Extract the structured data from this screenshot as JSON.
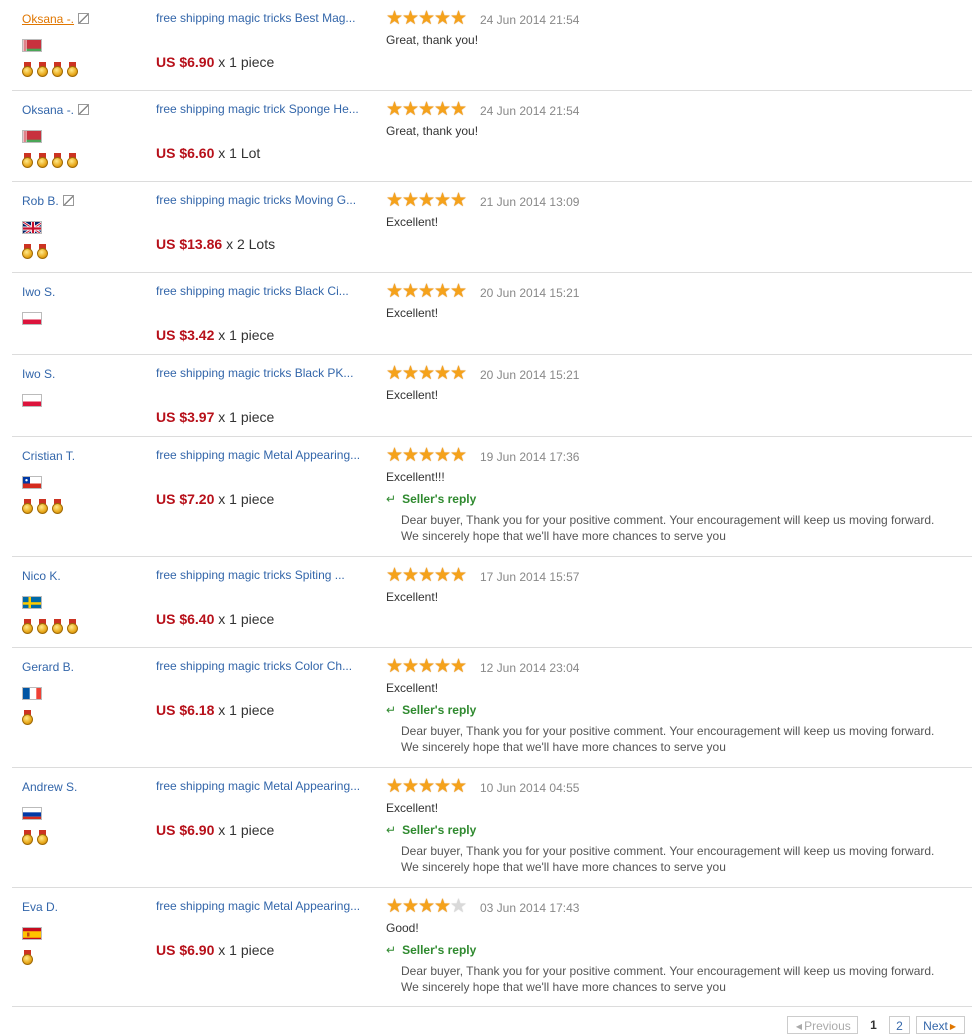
{
  "feedback": [
    {
      "buyer": "Oksana -.",
      "highlight": true,
      "edit_icon": true,
      "flag": "belarus",
      "medals": 4,
      "product": "free shipping magic tricks Best Mag...",
      "price": "US $6.90",
      "qty": "x 1 piece",
      "stars": 5,
      "date": "24 Jun 2014 21:54",
      "comment": "Great, thank you!",
      "reply": null
    },
    {
      "buyer": "Oksana -.",
      "highlight": false,
      "edit_icon": true,
      "flag": "belarus",
      "medals": 4,
      "product": "free shipping magic trick Sponge He...",
      "price": "US $6.60",
      "qty": "x 1 Lot",
      "stars": 5,
      "date": "24 Jun 2014 21:54",
      "comment": "Great, thank you!",
      "reply": null
    },
    {
      "buyer": "Rob B.",
      "highlight": false,
      "edit_icon": true,
      "flag": "uk",
      "medals": 2,
      "product": "free shipping magic tricks Moving G...",
      "price": "US $13.86",
      "qty": "x 2 Lots",
      "stars": 5,
      "date": "21 Jun 2014 13:09",
      "comment": "Excellent!",
      "reply": null
    },
    {
      "buyer": "Iwo S.",
      "highlight": false,
      "edit_icon": false,
      "flag": "poland",
      "medals": 0,
      "product": "free shipping magic tricks Black Ci...",
      "price": "US $3.42",
      "qty": "x 1 piece",
      "stars": 5,
      "date": "20 Jun 2014 15:21",
      "comment": "Excellent!",
      "reply": null
    },
    {
      "buyer": "Iwo S.",
      "highlight": false,
      "edit_icon": false,
      "flag": "poland",
      "medals": 0,
      "product": "free shipping magic tricks Black PK...",
      "price": "US $3.97",
      "qty": "x 1 piece",
      "stars": 5,
      "date": "20 Jun 2014 15:21",
      "comment": "Excellent!",
      "reply": null
    },
    {
      "buyer": "Cristian T.",
      "highlight": false,
      "edit_icon": false,
      "flag": "chile",
      "medals": 3,
      "product": "free shipping magic Metal Appearing...",
      "price": "US $7.20",
      "qty": "x 1 piece",
      "stars": 5,
      "date": "19 Jun 2014 17:36",
      "comment": "Excellent!!!",
      "reply": {
        "title": "Seller's reply",
        "lines": [
          "Dear buyer, Thank you for your positive comment. Your encouragement will keep us moving forward.",
          "We sincerely hope that we'll have more chances to serve you"
        ]
      }
    },
    {
      "buyer": "Nico K.",
      "highlight": false,
      "edit_icon": false,
      "flag": "sweden",
      "medals": 4,
      "product": "free shipping magic tricks Spiting ...",
      "price": "US $6.40",
      "qty": "x 1 piece",
      "stars": 5,
      "date": "17 Jun 2014 15:57",
      "comment": "Excellent!",
      "reply": null
    },
    {
      "buyer": "Gerard B.",
      "highlight": false,
      "edit_icon": false,
      "flag": "france",
      "medals": 1,
      "product": "free shipping magic tricks Color Ch...",
      "price": "US $6.18",
      "qty": "x 1 piece",
      "stars": 5,
      "date": "12 Jun 2014 23:04",
      "comment": "Excellent!",
      "reply": {
        "title": "Seller's reply",
        "lines": [
          "Dear buyer, Thank you for your positive comment. Your encouragement will keep us moving forward.",
          "We sincerely hope that we'll have more chances to serve you"
        ]
      }
    },
    {
      "buyer": "Andrew S.",
      "highlight": false,
      "edit_icon": false,
      "flag": "russia",
      "medals": 2,
      "product": "free shipping magic Metal Appearing...",
      "price": "US $6.90",
      "qty": "x 1 piece",
      "stars": 5,
      "date": "10 Jun 2014 04:55",
      "comment": "Excellent!",
      "reply": {
        "title": "Seller's reply",
        "lines": [
          "Dear buyer, Thank you for your positive comment. Your encouragement will keep us moving forward.",
          "We sincerely hope that we'll have more chances to serve you"
        ]
      }
    },
    {
      "buyer": "Eva D.",
      "highlight": false,
      "edit_icon": false,
      "flag": "spain",
      "medals": 1,
      "product": "free shipping magic Metal Appearing...",
      "price": "US $6.90",
      "qty": "x 1 piece",
      "stars": 4,
      "date": "03 Jun 2014 17:43",
      "comment": "Good!",
      "reply": {
        "title": "Seller's reply",
        "lines": [
          "Dear buyer, Thank you for your positive comment. Your encouragement will keep us moving forward.",
          "We sincerely hope that we'll have more chances to serve you"
        ]
      }
    }
  ],
  "pager": {
    "previous": "Previous",
    "pages": [
      "1",
      "2"
    ],
    "current": "1",
    "next": "Next"
  },
  "colors": {
    "link": "#3366aa",
    "price": "#b7101a",
    "reply": "#2f8a2f",
    "star": "#f5a21b",
    "highlight": "#e07600"
  }
}
